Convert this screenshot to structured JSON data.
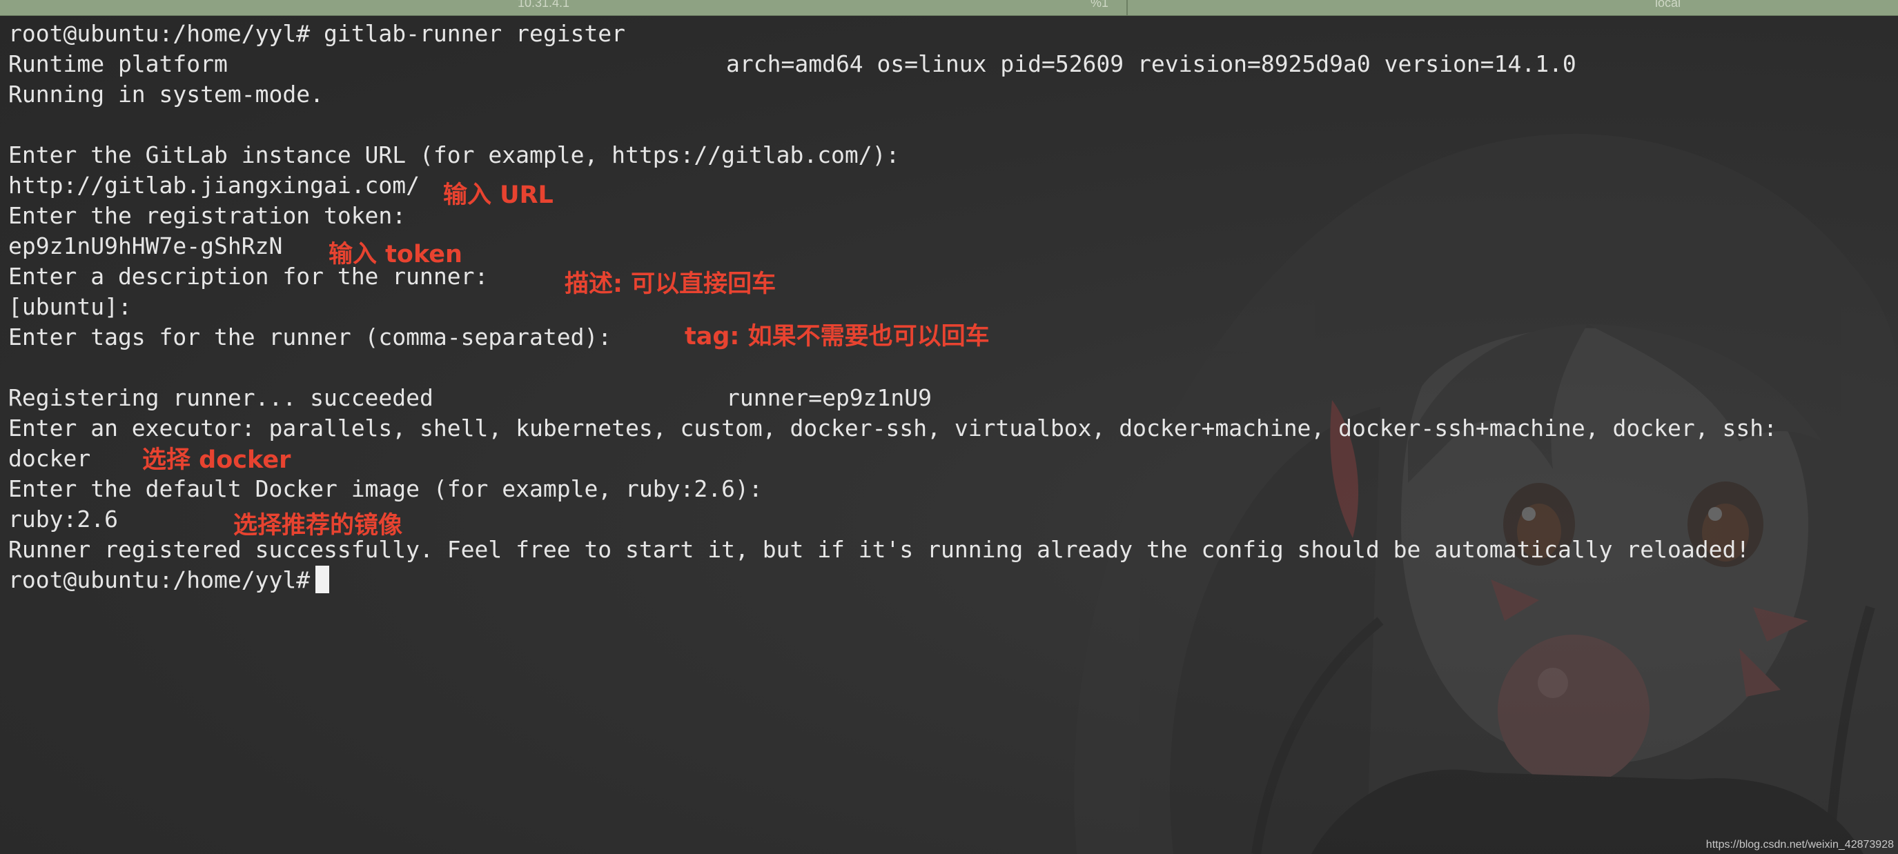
{
  "tabs": [
    "10.31.4.1",
    "%1",
    "local"
  ],
  "terminal": {
    "lines": [
      "root@ubuntu:/home/yyl# gitlab-runner register",
      "Runtime platform",
      "Running in system-mode.",
      "",
      "Enter the GitLab instance URL (for example, https://gitlab.com/):",
      "http://gitlab.jiangxingai.com/",
      "Enter the registration token:",
      "ep9z1nU9hHW7e-gShRzN",
      "Enter a description for the runner:",
      "[ubuntu]:",
      "Enter tags for the runner (comma-separated):",
      "",
      "Registering runner... succeeded",
      "Enter an executor: parallels, shell, kubernetes, custom, docker-ssh, virtualbox, docker+machine, docker-ssh+machine, docker, ssh:",
      "docker",
      "Enter the default Docker image (for example, ruby:2.6):",
      "ruby:2.6",
      "Runner registered successfully. Feel free to start it, but if it's running already the config should be automatically reloaded!",
      "root@ubuntu:/home/yyl#"
    ],
    "platform_info": "arch=amd64 os=linux pid=52609 revision=8925d9a0 version=14.1.0",
    "runner_info": "runner=ep9z1nU9"
  },
  "annotations": {
    "url": "输入 URL",
    "token": "输入 token",
    "description": "描述: 可以直接回车",
    "tags": "tag: 如果不需要也可以回车",
    "executor": "选择 docker",
    "image": "选择推荐的镜像"
  },
  "watermark": "https://blog.csdn.net/weixin_42873928",
  "colors": {
    "background": "#2b2b2b",
    "text": "#e6e6e6",
    "annotation": "#e84330",
    "tabbar": "#8ea283"
  }
}
